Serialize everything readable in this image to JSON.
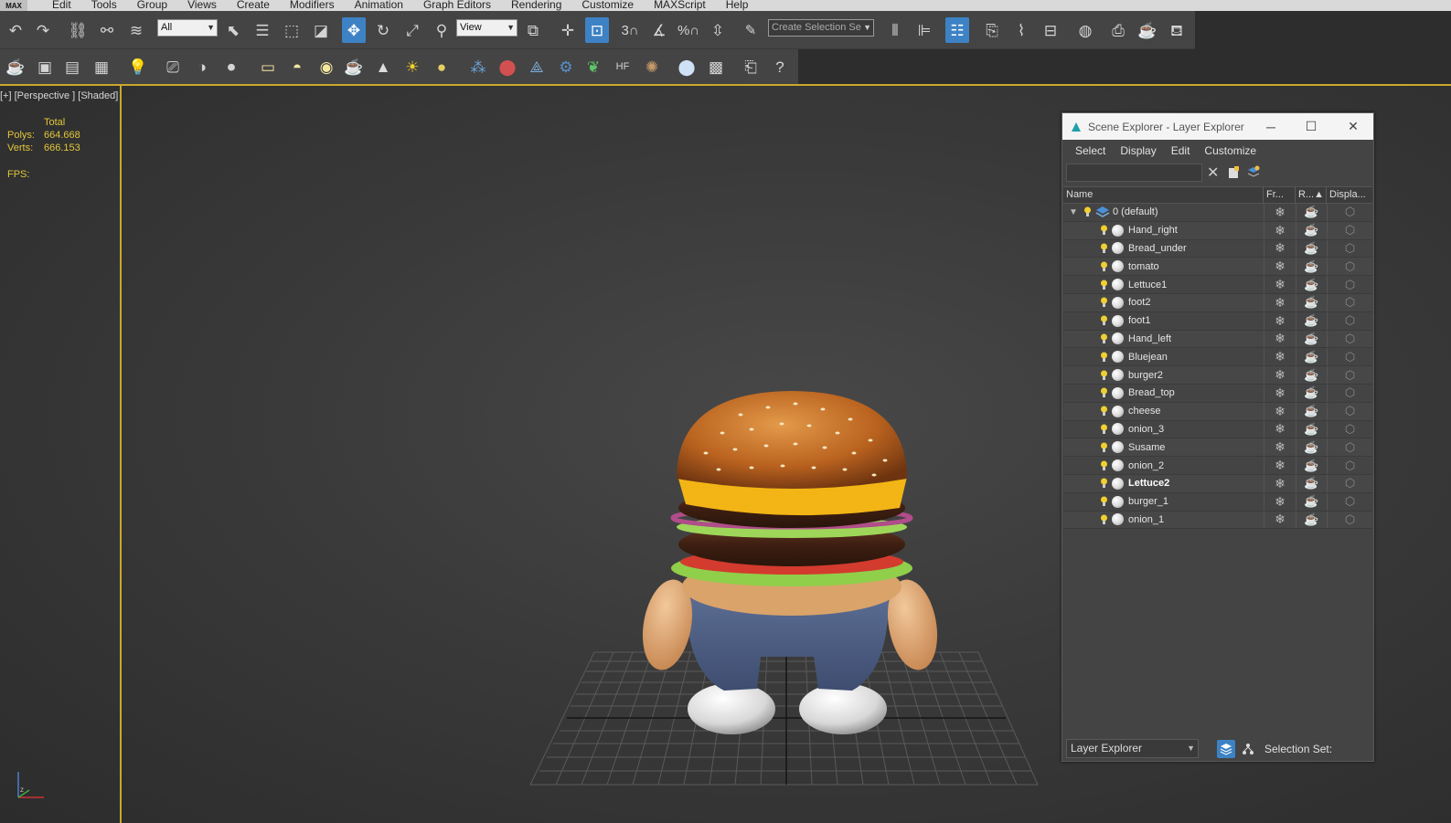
{
  "menubar": {
    "logo": "MAX",
    "items": [
      "Edit",
      "Tools",
      "Group",
      "Views",
      "Create",
      "Modifiers",
      "Animation",
      "Graph Editors",
      "Rendering",
      "Customize",
      "MAXScript",
      "Help"
    ]
  },
  "toolbar": {
    "selection_filter": "All",
    "reference_coord": "View",
    "snap_angle_label": "3",
    "create_selection_set": "Create Selection Se"
  },
  "viewport": {
    "label": "[+] [Perspective ] [Shaded]",
    "stats_header": "Total",
    "polys_label": "Polys:",
    "polys_value": "664.668",
    "verts_label": "Verts:",
    "verts_value": "666.153",
    "fps_label": "FPS:"
  },
  "explorer": {
    "title": "Scene Explorer - Layer Explorer",
    "menu": [
      "Select",
      "Display",
      "Edit",
      "Customize"
    ],
    "columns": [
      "Name",
      "Fr...",
      "R...▲",
      "Displa..."
    ],
    "layer_name": "0 (default)",
    "objects": [
      "Hand_right",
      "Bread_under",
      "tomato",
      "Lettuce1",
      "foot2",
      "foot1",
      "Hand_left",
      "Bluejean",
      "burger2",
      "Bread_top",
      "cheese",
      "onion_3",
      "Susame",
      "onion_2",
      "Lettuce2",
      "burger_1",
      "onion_1"
    ],
    "bold_object": "Lettuce2",
    "bottom_mode": "Layer Explorer",
    "selection_set_label": "Selection Set:"
  },
  "colors": {
    "accent_blue": "#3d82c4",
    "stats_yellow": "#e3c63a",
    "viewport_border": "#c9a82c",
    "toolbar_bg": "#444444"
  }
}
